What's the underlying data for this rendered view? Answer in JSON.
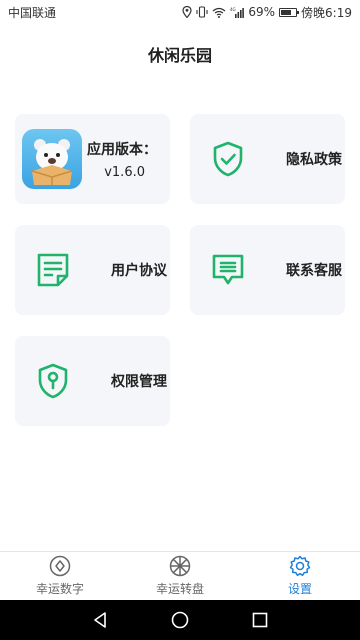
{
  "status": {
    "carrier": "中国联通",
    "battery_percent": "69%",
    "battery_level": 0.69,
    "time": "傍晚6:19"
  },
  "page": {
    "title": "休闲乐园"
  },
  "cards": {
    "version": {
      "label": "应用版本：",
      "value": "v1.6.0"
    },
    "privacy": {
      "label": "隐私政策",
      "icon": "shield-check-icon"
    },
    "agreement": {
      "label": "用户协议",
      "icon": "document-icon"
    },
    "service": {
      "label": "联系客服",
      "icon": "message-icon"
    },
    "permission": {
      "label": "权限管理",
      "icon": "shield-key-icon"
    }
  },
  "nav": {
    "items": [
      {
        "label": "幸运数字",
        "icon": "coin-icon",
        "active": false
      },
      {
        "label": "幸运转盘",
        "icon": "wheel-icon",
        "active": false
      },
      {
        "label": "设置",
        "icon": "gear-icon",
        "active": true
      }
    ]
  },
  "colors": {
    "accent_green": "#1fb36b",
    "active_blue": "#1e7fd8",
    "card_bg": "#f4f6f9"
  }
}
